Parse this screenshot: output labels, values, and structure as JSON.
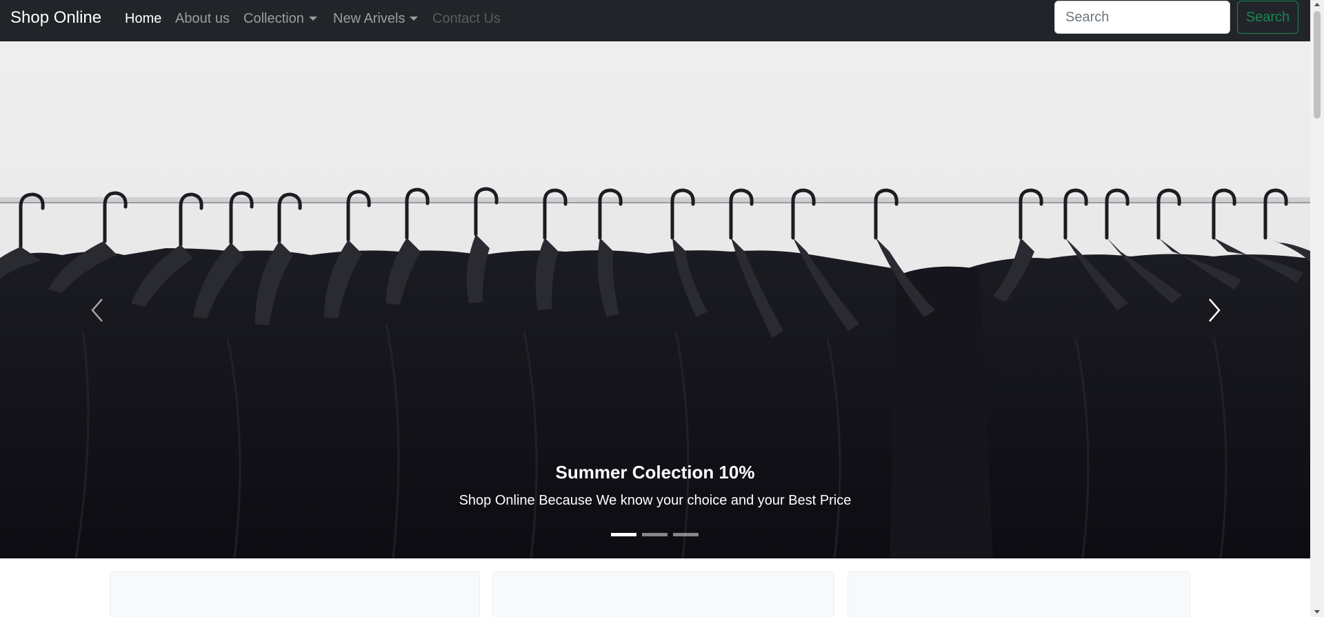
{
  "navbar": {
    "brand": "Shop Online",
    "links": [
      {
        "label": "Home"
      },
      {
        "label": "About us"
      },
      {
        "label": "Collection"
      },
      {
        "label": "New Arivels"
      },
      {
        "label": "Contact Us"
      }
    ],
    "search": {
      "placeholder": "Search",
      "button_label": "Search"
    }
  },
  "carousel": {
    "caption_title": "Summer Colection 10%",
    "caption_text": "Shop Online Because We know your choice and your Best Price",
    "active_slide": 1,
    "slide_count": 3
  },
  "icons": {
    "prev": "chevron-left-icon",
    "next": "chevron-right-icon",
    "dropdown": "caret-down-icon"
  },
  "colors": {
    "navbar_bg": "#212529",
    "search_accent": "#198754",
    "card_bg": "#f8f9fa"
  }
}
